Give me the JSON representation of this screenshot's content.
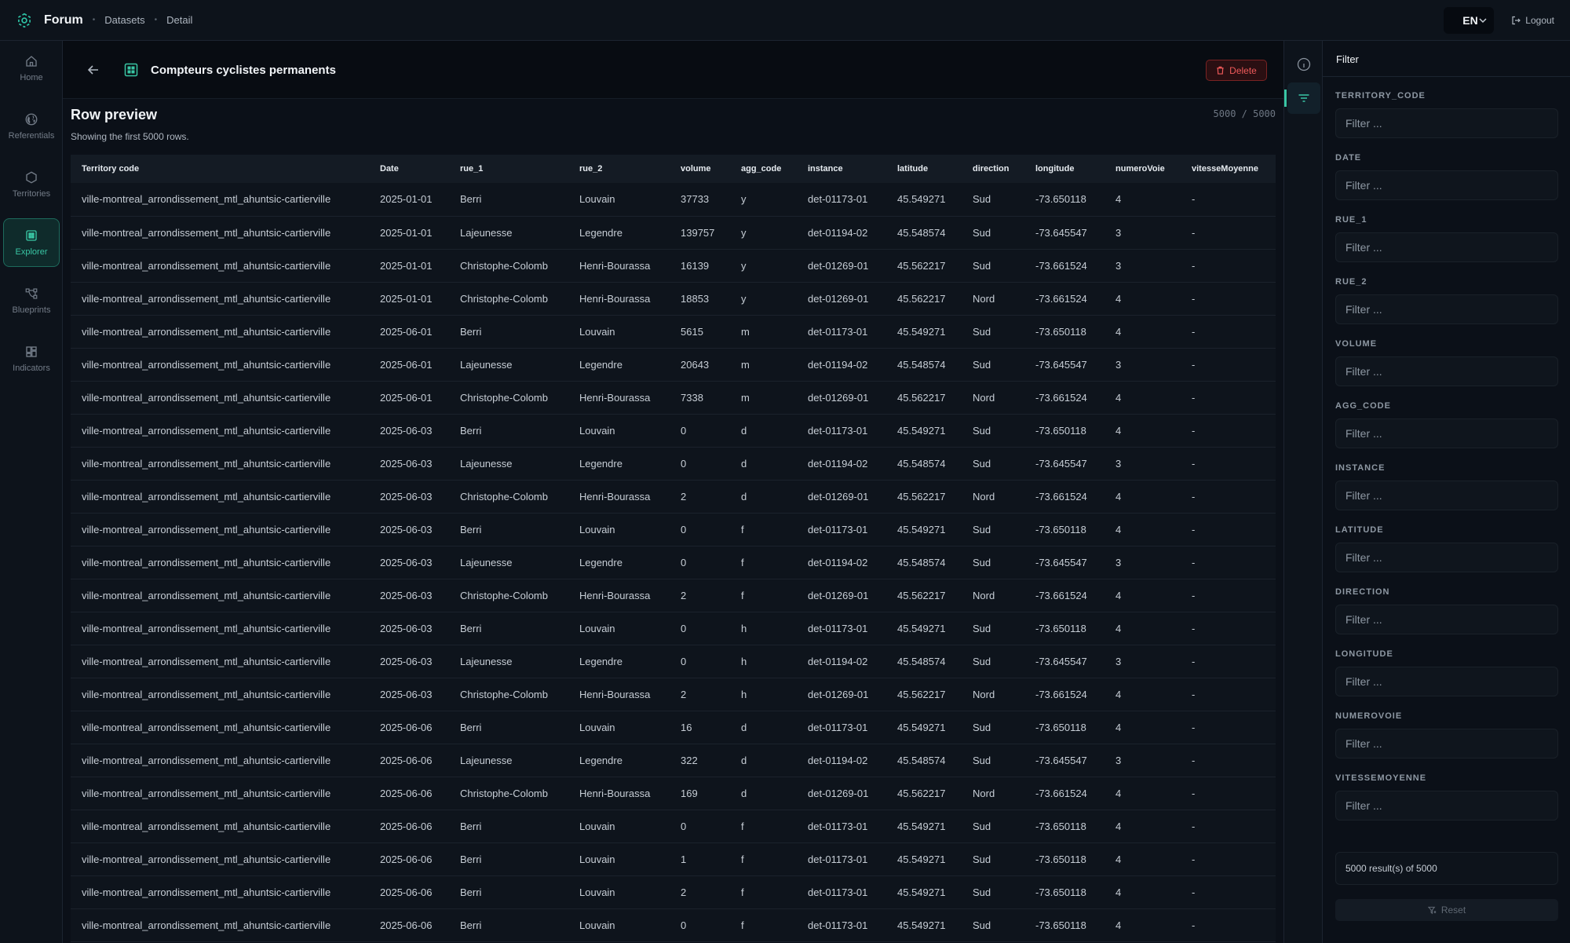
{
  "header": {
    "brand": "Forum",
    "breadcrumb": [
      "Datasets",
      "Detail"
    ],
    "language": "EN",
    "logout_label": "Logout"
  },
  "sidebar": {
    "items": [
      {
        "label": "Home",
        "icon": "home-icon"
      },
      {
        "label": "Referentials",
        "icon": "globe-icon"
      },
      {
        "label": "Territories",
        "icon": "hexagon-icon"
      },
      {
        "label": "Explorer",
        "icon": "grid-icon",
        "active": true
      },
      {
        "label": "Blueprints",
        "icon": "workflow-icon"
      },
      {
        "label": "Indicators",
        "icon": "dashboard-icon"
      }
    ]
  },
  "dataset": {
    "title": "Compteurs cyclistes permanents",
    "delete_label": "Delete"
  },
  "preview": {
    "title": "Row preview",
    "subtitle": "Showing the first 5000 rows.",
    "count": "5000 / 5000"
  },
  "table": {
    "columns": [
      "Territory code",
      "Date",
      "rue_1",
      "rue_2",
      "volume",
      "agg_code",
      "instance",
      "latitude",
      "direction",
      "longitude",
      "numeroVoie",
      "vitesseMoyenne"
    ],
    "rows": [
      [
        "ville-montreal_arrondissement_mtl_ahuntsic-cartierville",
        "2025-01-01",
        "Berri",
        "Louvain",
        "37733",
        "y",
        "det-01173-01",
        "45.549271",
        "Sud",
        "-73.650118",
        "4",
        "-"
      ],
      [
        "ville-montreal_arrondissement_mtl_ahuntsic-cartierville",
        "2025-01-01",
        "Lajeunesse",
        "Legendre",
        "139757",
        "y",
        "det-01194-02",
        "45.548574",
        "Sud",
        "-73.645547",
        "3",
        "-"
      ],
      [
        "ville-montreal_arrondissement_mtl_ahuntsic-cartierville",
        "2025-01-01",
        "Christophe-Colomb",
        "Henri-Bourassa",
        "16139",
        "y",
        "det-01269-01",
        "45.562217",
        "Sud",
        "-73.661524",
        "3",
        "-"
      ],
      [
        "ville-montreal_arrondissement_mtl_ahuntsic-cartierville",
        "2025-01-01",
        "Christophe-Colomb",
        "Henri-Bourassa",
        "18853",
        "y",
        "det-01269-01",
        "45.562217",
        "Nord",
        "-73.661524",
        "4",
        "-"
      ],
      [
        "ville-montreal_arrondissement_mtl_ahuntsic-cartierville",
        "2025-06-01",
        "Berri",
        "Louvain",
        "5615",
        "m",
        "det-01173-01",
        "45.549271",
        "Sud",
        "-73.650118",
        "4",
        "-"
      ],
      [
        "ville-montreal_arrondissement_mtl_ahuntsic-cartierville",
        "2025-06-01",
        "Lajeunesse",
        "Legendre",
        "20643",
        "m",
        "det-01194-02",
        "45.548574",
        "Sud",
        "-73.645547",
        "3",
        "-"
      ],
      [
        "ville-montreal_arrondissement_mtl_ahuntsic-cartierville",
        "2025-06-01",
        "Christophe-Colomb",
        "Henri-Bourassa",
        "7338",
        "m",
        "det-01269-01",
        "45.562217",
        "Nord",
        "-73.661524",
        "4",
        "-"
      ],
      [
        "ville-montreal_arrondissement_mtl_ahuntsic-cartierville",
        "2025-06-03",
        "Berri",
        "Louvain",
        "0",
        "d",
        "det-01173-01",
        "45.549271",
        "Sud",
        "-73.650118",
        "4",
        "-"
      ],
      [
        "ville-montreal_arrondissement_mtl_ahuntsic-cartierville",
        "2025-06-03",
        "Lajeunesse",
        "Legendre",
        "0",
        "d",
        "det-01194-02",
        "45.548574",
        "Sud",
        "-73.645547",
        "3",
        "-"
      ],
      [
        "ville-montreal_arrondissement_mtl_ahuntsic-cartierville",
        "2025-06-03",
        "Christophe-Colomb",
        "Henri-Bourassa",
        "2",
        "d",
        "det-01269-01",
        "45.562217",
        "Nord",
        "-73.661524",
        "4",
        "-"
      ],
      [
        "ville-montreal_arrondissement_mtl_ahuntsic-cartierville",
        "2025-06-03",
        "Berri",
        "Louvain",
        "0",
        "f",
        "det-01173-01",
        "45.549271",
        "Sud",
        "-73.650118",
        "4",
        "-"
      ],
      [
        "ville-montreal_arrondissement_mtl_ahuntsic-cartierville",
        "2025-06-03",
        "Lajeunesse",
        "Legendre",
        "0",
        "f",
        "det-01194-02",
        "45.548574",
        "Sud",
        "-73.645547",
        "3",
        "-"
      ],
      [
        "ville-montreal_arrondissement_mtl_ahuntsic-cartierville",
        "2025-06-03",
        "Christophe-Colomb",
        "Henri-Bourassa",
        "2",
        "f",
        "det-01269-01",
        "45.562217",
        "Nord",
        "-73.661524",
        "4",
        "-"
      ],
      [
        "ville-montreal_arrondissement_mtl_ahuntsic-cartierville",
        "2025-06-03",
        "Berri",
        "Louvain",
        "0",
        "h",
        "det-01173-01",
        "45.549271",
        "Sud",
        "-73.650118",
        "4",
        "-"
      ],
      [
        "ville-montreal_arrondissement_mtl_ahuntsic-cartierville",
        "2025-06-03",
        "Lajeunesse",
        "Legendre",
        "0",
        "h",
        "det-01194-02",
        "45.548574",
        "Sud",
        "-73.645547",
        "3",
        "-"
      ],
      [
        "ville-montreal_arrondissement_mtl_ahuntsic-cartierville",
        "2025-06-03",
        "Christophe-Colomb",
        "Henri-Bourassa",
        "2",
        "h",
        "det-01269-01",
        "45.562217",
        "Nord",
        "-73.661524",
        "4",
        "-"
      ],
      [
        "ville-montreal_arrondissement_mtl_ahuntsic-cartierville",
        "2025-06-06",
        "Berri",
        "Louvain",
        "16",
        "d",
        "det-01173-01",
        "45.549271",
        "Sud",
        "-73.650118",
        "4",
        "-"
      ],
      [
        "ville-montreal_arrondissement_mtl_ahuntsic-cartierville",
        "2025-06-06",
        "Lajeunesse",
        "Legendre",
        "322",
        "d",
        "det-01194-02",
        "45.548574",
        "Sud",
        "-73.645547",
        "3",
        "-"
      ],
      [
        "ville-montreal_arrondissement_mtl_ahuntsic-cartierville",
        "2025-06-06",
        "Christophe-Colomb",
        "Henri-Bourassa",
        "169",
        "d",
        "det-01269-01",
        "45.562217",
        "Nord",
        "-73.661524",
        "4",
        "-"
      ],
      [
        "ville-montreal_arrondissement_mtl_ahuntsic-cartierville",
        "2025-06-06",
        "Berri",
        "Louvain",
        "0",
        "f",
        "det-01173-01",
        "45.549271",
        "Sud",
        "-73.650118",
        "4",
        "-"
      ],
      [
        "ville-montreal_arrondissement_mtl_ahuntsic-cartierville",
        "2025-06-06",
        "Berri",
        "Louvain",
        "1",
        "f",
        "det-01173-01",
        "45.549271",
        "Sud",
        "-73.650118",
        "4",
        "-"
      ],
      [
        "ville-montreal_arrondissement_mtl_ahuntsic-cartierville",
        "2025-06-06",
        "Berri",
        "Louvain",
        "2",
        "f",
        "det-01173-01",
        "45.549271",
        "Sud",
        "-73.650118",
        "4",
        "-"
      ],
      [
        "ville-montreal_arrondissement_mtl_ahuntsic-cartierville",
        "2025-06-06",
        "Berri",
        "Louvain",
        "0",
        "f",
        "det-01173-01",
        "45.549271",
        "Sud",
        "-73.650118",
        "4",
        "-"
      ]
    ]
  },
  "filter": {
    "title": "Filter",
    "fields": [
      {
        "label": "TERRITORY_CODE",
        "placeholder": "Filter ..."
      },
      {
        "label": "DATE",
        "placeholder": "Filter ..."
      },
      {
        "label": "RUE_1",
        "placeholder": "Filter ..."
      },
      {
        "label": "RUE_2",
        "placeholder": "Filter ..."
      },
      {
        "label": "VOLUME",
        "placeholder": "Filter ..."
      },
      {
        "label": "AGG_CODE",
        "placeholder": "Filter ..."
      },
      {
        "label": "INSTANCE",
        "placeholder": "Filter ..."
      },
      {
        "label": "LATITUDE",
        "placeholder": "Filter ..."
      },
      {
        "label": "DIRECTION",
        "placeholder": "Filter ..."
      },
      {
        "label": "LONGITUDE",
        "placeholder": "Filter ..."
      },
      {
        "label": "NUMEROVOIE",
        "placeholder": "Filter ..."
      },
      {
        "label": "VITESSEMOYENNE",
        "placeholder": "Filter ..."
      }
    ],
    "results": "5000 result(s) of 5000",
    "reset_label": "Reset"
  },
  "colors": {
    "accent": "#39c6a4",
    "danger": "#ef5a5a",
    "background": "#0b1018"
  }
}
